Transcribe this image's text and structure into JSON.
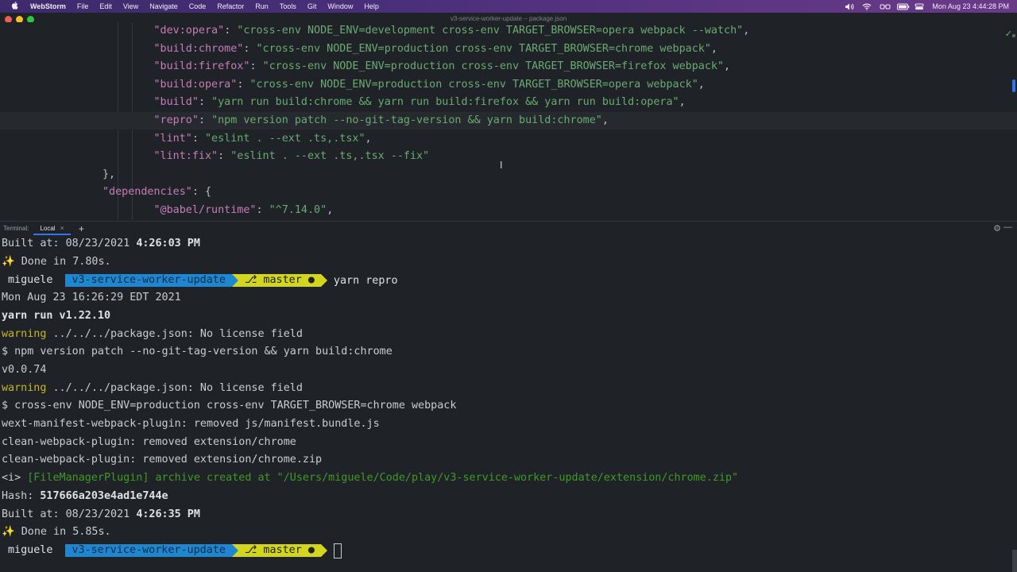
{
  "menubar": {
    "app_name": "WebStorm",
    "items": [
      "File",
      "Edit",
      "View",
      "Navigate",
      "Code",
      "Refactor",
      "Run",
      "Tools",
      "Git",
      "Window",
      "Help"
    ],
    "datetime": "Mon Aug 23  4:44:28 PM"
  },
  "window": {
    "title": "v3-service-worker-update – package.json"
  },
  "editor": {
    "lines": [
      {
        "indent": "      ",
        "key": "\"dev:opera\"",
        "value": "\"cross-env NODE_ENV=development cross-env TARGET_BROWSER=opera webpack --watch\"",
        "tail": ","
      },
      {
        "indent": "      ",
        "key": "\"build:chrome\"",
        "value": "\"cross-env NODE_ENV=production cross-env TARGET_BROWSER=chrome webpack\"",
        "tail": ","
      },
      {
        "indent": "      ",
        "key": "\"build:firefox\"",
        "value": "\"cross-env NODE_ENV=production cross-env TARGET_BROWSER=firefox webpack\"",
        "tail": ","
      },
      {
        "indent": "      ",
        "key": "\"build:opera\"",
        "value": "\"cross-env NODE_ENV=production cross-env TARGET_BROWSER=opera webpack\"",
        "tail": ","
      },
      {
        "indent": "      ",
        "key": "\"build\"",
        "value": "\"yarn run build:chrome && yarn run build:firefox && yarn run build:opera\"",
        "tail": ","
      },
      {
        "indent": "      ",
        "key": "\"repro\"",
        "value": "\"npm version patch --no-git-tag-version && yarn build:chrome\"",
        "tail": ","
      },
      {
        "indent": "      ",
        "key": "\"lint\"",
        "value": "\"eslint . --ext .ts,.tsx\"",
        "tail": ","
      },
      {
        "indent": "      ",
        "key": "\"lint:fix\"",
        "value": "\"eslint . --ext .ts,.tsx --fix\"",
        "tail": ""
      },
      {
        "indent": "    ",
        "key": "",
        "value": "",
        "tail": "},"
      },
      {
        "indent": "    ",
        "key": "\"dependencies\"",
        "value": "",
        "tail": "{"
      },
      {
        "indent": "      ",
        "key": "\"@babel/runtime\"",
        "value": "\"^7.14.0\"",
        "tail": ","
      }
    ]
  },
  "terminal": {
    "label": "Terminal:",
    "tab": "Local",
    "add_label": "+",
    "prompt": {
      "user": "miguele",
      "dir": "v3-service-worker-update",
      "branch": "⎇ master ●"
    },
    "built1": {
      "prefix": "Built at: 08/23/2021 ",
      "time": "4:26:03 PM"
    },
    "done1": {
      "spark": "✨",
      "text": " Done in 7.80s."
    },
    "command": "yarn repro",
    "date_line": "Mon Aug 23 16:26:29 EDT 2021",
    "yarn_line": "yarn run v1.22.10",
    "warn1": {
      "label": "warning",
      "text": " ../../../package.json: No license field"
    },
    "npm_line": "$ npm version patch --no-git-tag-version && yarn build:chrome",
    "version_line": "v0.0.74",
    "warn2": {
      "label": "warning",
      "text": " ../../../package.json: No license field"
    },
    "crossenv_line": "$ cross-env NODE_ENV=production cross-env TARGET_BROWSER=chrome webpack",
    "wext_line": "wext-manifest-webpack-plugin: removed js/manifest.bundle.js",
    "clean1": "clean-webpack-plugin: removed extension/chrome",
    "clean2": "clean-webpack-plugin: removed extension/chrome.zip",
    "info": {
      "tag": "<i>",
      "text": " [FileManagerPlugin] archive created at \"/Users/miguele/Code/play/v3-service-worker-update/extension/chrome.zip\""
    },
    "hash": {
      "prefix": "Hash: ",
      "value": "517666a203e4ad1e744e"
    },
    "built2": {
      "prefix": "Built at: 08/23/2021 ",
      "time": "4:26:35 PM"
    },
    "done2": {
      "spark": "✨",
      "text": " Done in 5.85s."
    }
  },
  "colors": {
    "dir_segment": "#1f86d0",
    "git_segment": "#d3d61f",
    "json_key": "#c77dbb",
    "json_string": "#6aab73"
  }
}
